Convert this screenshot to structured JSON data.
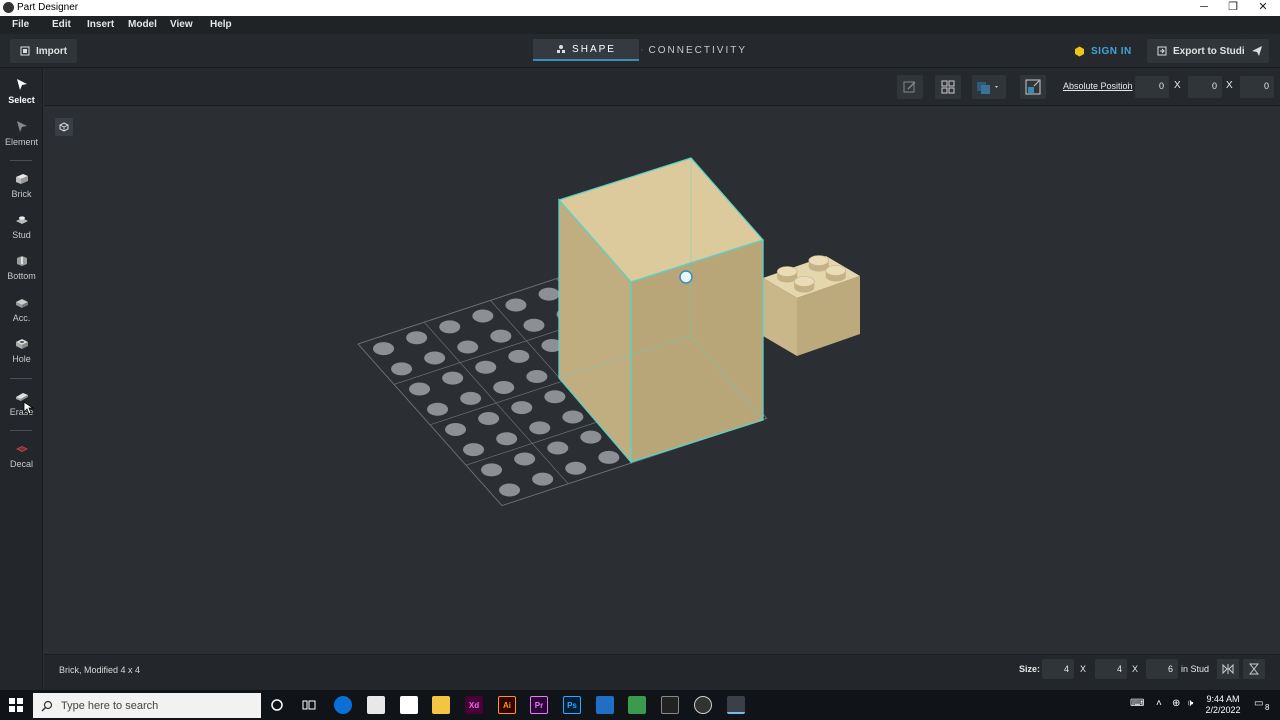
{
  "window": {
    "title": "Part Designer",
    "controls": [
      "─",
      "❐",
      "✕"
    ]
  },
  "menu": [
    "File",
    "Edit",
    "Insert",
    "Model",
    "View",
    "Help"
  ],
  "toolbar": {
    "import_label": "Import",
    "tabs": [
      {
        "label": "SHAPE",
        "active": true
      },
      {
        "label": "CONNECTIVITY",
        "active": false
      }
    ],
    "sign_in_label": "SIGN IN",
    "export_label": "Export to Studio"
  },
  "sidebar": [
    {
      "label": "Select",
      "icon": "cursor-icon",
      "active": true
    },
    {
      "label": "Element",
      "icon": "element-cursor-icon",
      "active": false
    },
    {
      "label": "Brick",
      "icon": "brick-icon",
      "active": false
    },
    {
      "label": "Stud",
      "icon": "stud-icon",
      "active": false
    },
    {
      "label": "Bottom",
      "icon": "bottom-icon",
      "active": false
    },
    {
      "label": "Acc.",
      "icon": "accessory-icon",
      "active": false
    },
    {
      "label": "Hole",
      "icon": "hole-icon",
      "active": false
    },
    {
      "label": "Erase",
      "icon": "eraser-icon",
      "active": false
    },
    {
      "label": "Decal",
      "icon": "decal-icon",
      "active": false
    }
  ],
  "viewbar": {
    "absolute_position_label": "Absolute Position",
    "position": [
      "0",
      "0",
      "0"
    ],
    "separator": "X"
  },
  "status": {
    "text": "Brick, Modified 4 x 4",
    "size_label": "Size:",
    "size": [
      "4",
      "4",
      "6"
    ],
    "unit": "in Stud"
  },
  "taskbar": {
    "search_placeholder": "Type here to search",
    "time": "9:44 AM",
    "date": "2/2/2022",
    "notifications": "8",
    "apps": [
      {
        "name": "Xd",
        "color": "#ff61f6",
        "bg": "#470137"
      },
      {
        "name": "Ai",
        "color": "#ff9a00",
        "bg": "#330000"
      },
      {
        "name": "Pr",
        "color": "#ea77ff",
        "bg": "#2a0634"
      },
      {
        "name": "Ps",
        "color": "#31a8ff",
        "bg": "#001e36"
      }
    ]
  },
  "colors": {
    "accent": "#3d8bb6",
    "sign_in": "#40a4d6",
    "brick": "#d8c79c",
    "selection": "#5ad3c4"
  }
}
